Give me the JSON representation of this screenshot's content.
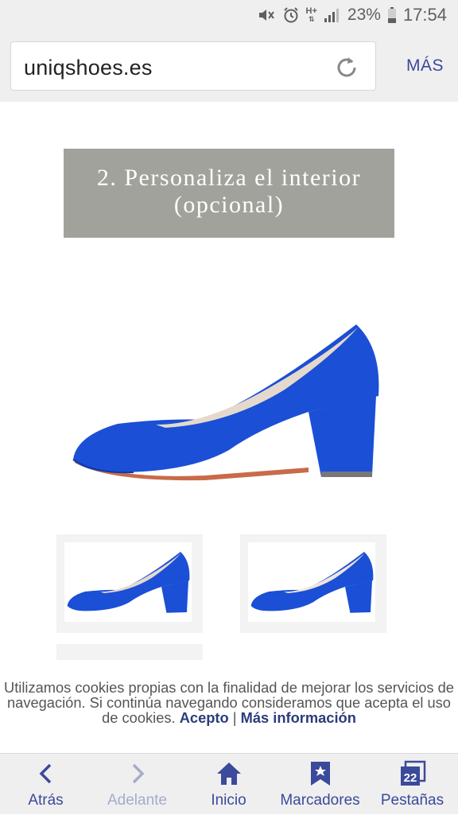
{
  "status_bar": {
    "battery": "23%",
    "time": "17:54",
    "network": "H+"
  },
  "browser": {
    "url": "uniqshoes.es",
    "more_label": "MÁS"
  },
  "page": {
    "banner_line1": "2. Personaliza el interior",
    "banner_line2": "(opcional)",
    "product_color": "#1b4fd6"
  },
  "cookie_notice": {
    "text": "Utilizamos cookies propias con la finalidad de mejorar los servicios de navegación. Si continúa navegando consideramos que acepta el uso de cookies.",
    "accept_label": "Acepto",
    "separator": "|",
    "more_info_label": "Más información"
  },
  "bottom_nav": {
    "items": [
      {
        "label": "Atrás",
        "icon": "back-chevron-icon"
      },
      {
        "label": "Adelante",
        "icon": "forward-chevron-icon"
      },
      {
        "label": "Inicio",
        "icon": "home-icon"
      },
      {
        "label": "Marcadores",
        "icon": "bookmark-star-icon"
      },
      {
        "label": "Pestañas",
        "icon": "tabs-icon",
        "badge": "22"
      }
    ]
  },
  "colors": {
    "accent": "#3b4a9a",
    "banner_bg": "#a2a29d",
    "chrome_bg": "#efefef"
  }
}
